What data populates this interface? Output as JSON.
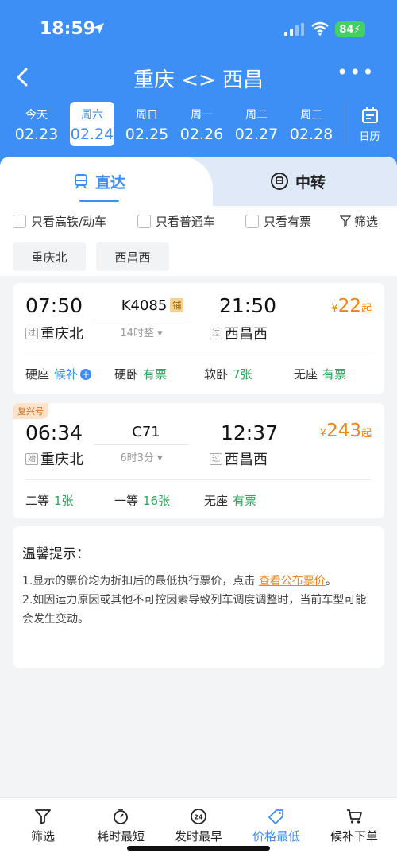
{
  "status": {
    "time": "18:59",
    "battery": "84"
  },
  "nav": {
    "title": "重庆 <> 西昌"
  },
  "dates": [
    {
      "weekday": "今天",
      "date": "02.23"
    },
    {
      "weekday": "周六",
      "date": "02.24"
    },
    {
      "weekday": "周日",
      "date": "02.25"
    },
    {
      "weekday": "周一",
      "date": "02.26"
    },
    {
      "weekday": "周二",
      "date": "02.27"
    },
    {
      "weekday": "周三",
      "date": "02.28"
    }
  ],
  "calendar_label": "日历",
  "tabs": {
    "direct": "直达",
    "transfer": "中转"
  },
  "filters": {
    "highspeed": "只看高铁/动车",
    "normal": "只看普通车",
    "available": "只看有票",
    "filter": "筛选"
  },
  "stations": [
    "重庆北",
    "西昌西"
  ],
  "trains": [
    {
      "badge": "",
      "dep_time": "07:50",
      "dep_tag": "过",
      "dep_station": "重庆北",
      "train_no": "K4085",
      "bunk": "铺",
      "duration": "14时整",
      "arr_time": "21:50",
      "arr_tag": "过",
      "arr_station": "西昌西",
      "price_yen": "¥",
      "price": "22",
      "price_suffix": "起",
      "seats": [
        {
          "name": "硬座",
          "value": "候补"
        },
        {
          "name": "硬卧",
          "value": "有票"
        },
        {
          "name": "软卧",
          "value": "7张"
        },
        {
          "name": "无座",
          "value": "有票"
        }
      ]
    },
    {
      "badge": "复兴号",
      "dep_time": "06:34",
      "dep_tag": "始",
      "dep_station": "重庆北",
      "train_no": "C71",
      "bunk": "",
      "duration": "6时3分",
      "arr_time": "12:37",
      "arr_tag": "过",
      "arr_station": "西昌西",
      "price_yen": "¥",
      "price": "243",
      "price_suffix": "起",
      "seats": [
        {
          "name": "二等",
          "value": "1张"
        },
        {
          "name": "一等",
          "value": "16张"
        },
        {
          "name": "无座",
          "value": "有票"
        }
      ]
    }
  ],
  "tips": {
    "title": "温馨提示：",
    "line1_pre": "1.显示的票价均为折扣后的最低执行票价，点击 ",
    "line1_link": "查看公布票价",
    "line1_post": "。",
    "line2": "2.如因运力原因或其他不可控因素导致列车调度调整时，当前车型可能会发生变动。"
  },
  "bottom": [
    {
      "label": "筛选"
    },
    {
      "label": "耗时最短"
    },
    {
      "label": "发时最早"
    },
    {
      "label": "价格最低"
    },
    {
      "label": "候补下单"
    }
  ],
  "colors": {
    "primary": "#3d8ef5",
    "price": "#f08416",
    "green": "#2aa85a"
  }
}
